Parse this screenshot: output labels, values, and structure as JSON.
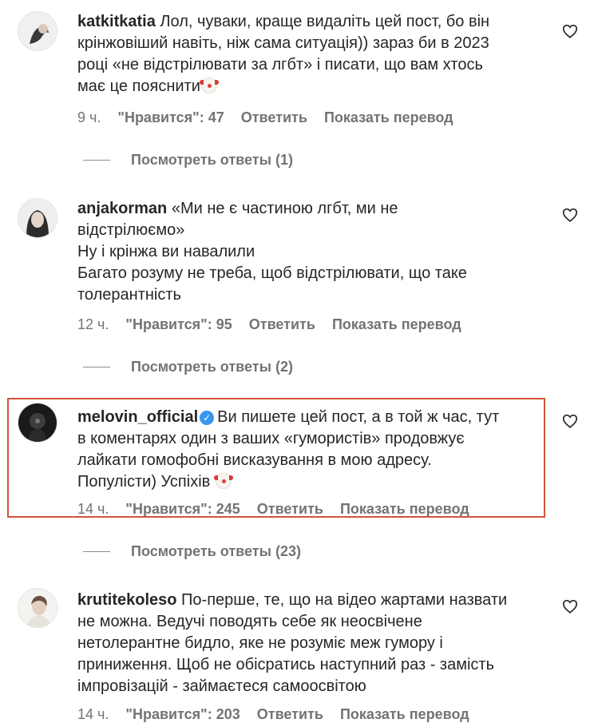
{
  "comments": [
    {
      "username": "katkitkatia",
      "text": " Лол, чуваки, краще видаліть цей пост, бо він\nкрінжовіший навіть, ніж сама ситуація)) зараз би в 2023\nроці «не відстрілювати за лгбт» і писати, що вам хтось\nмає це пояснити",
      "time": "9 ч.",
      "likes": "\"Нравится\": 47",
      "reply": "Ответить",
      "translate": "Показать перевод",
      "view_replies": "Посмотреть ответы (1)"
    },
    {
      "username": "anjakorman",
      "text": " «Ми не є частиною лгбт, ми не\nвідстрілюємо»\nНу і крінжа ви навалили\nБагато розуму не треба, щоб відстрілювати, що таке\nтолерантність",
      "time": "12 ч.",
      "likes": "\"Нравится\": 95",
      "reply": "Ответить",
      "translate": "Показать перевод",
      "view_replies": "Посмотреть ответы (2)"
    },
    {
      "username": "melovin_official",
      "verified": true,
      "text": "Ви пишете цей пост, а в той ж час, тут\nв коментарях один з ваших «гумористів» продовжує\nлайкати гомофобні висказування в мою адресу.\nПопулісти) Успіхів ",
      "time": "14 ч.",
      "likes": "\"Нравится\": 245",
      "reply": "Ответить",
      "translate": "Показать перевод",
      "view_replies": "Посмотреть ответы (23)"
    },
    {
      "username": "krutitekoleso",
      "text": " По-перше, те, що на відео жартами назвати\nне можна. Ведучі поводять себе як неосвічене\nнетолерантне бидло, яке не розуміє меж гумору і\nприниження. Щоб не обісратись наступний раз - замість\nімпровізацій - займаєтеся самоосвітою",
      "time": "14 ч.",
      "likes": "\"Нравится\": 203",
      "reply": "Ответить",
      "translate": "Показать перевод"
    }
  ],
  "icons": {
    "like": "heart-outline-icon",
    "verified": "verified-badge-icon",
    "emoji": "clown-face-emoji"
  },
  "colors": {
    "highlight_border": "#d4543a",
    "meta_text": "#737373",
    "verified": "#3897f0"
  }
}
